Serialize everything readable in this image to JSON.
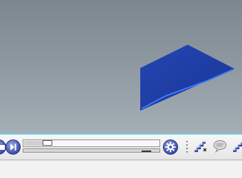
{
  "viewport": {
    "shape": "blue-quadrilateral",
    "colors": {
      "sky_top": "#7c8790",
      "sky_bottom": "#a5aeb5",
      "shape_fill": "#1e3fa6",
      "shape_edge": "#3b7cff"
    }
  },
  "toolbar": {
    "accent": "#6fd3e2",
    "playback": {
      "time_slider_progress": 0.15,
      "speed_slider_progress": 0.93
    },
    "icons": {
      "partial_left": "stop-icon",
      "next": "next-frame-icon",
      "settings": "gear-icon",
      "grip": "toolbar-grip-icon",
      "stairs": "stairs-close-icon",
      "comment": "speech-bubble-icon",
      "partial_right": "stairs-icon"
    }
  }
}
